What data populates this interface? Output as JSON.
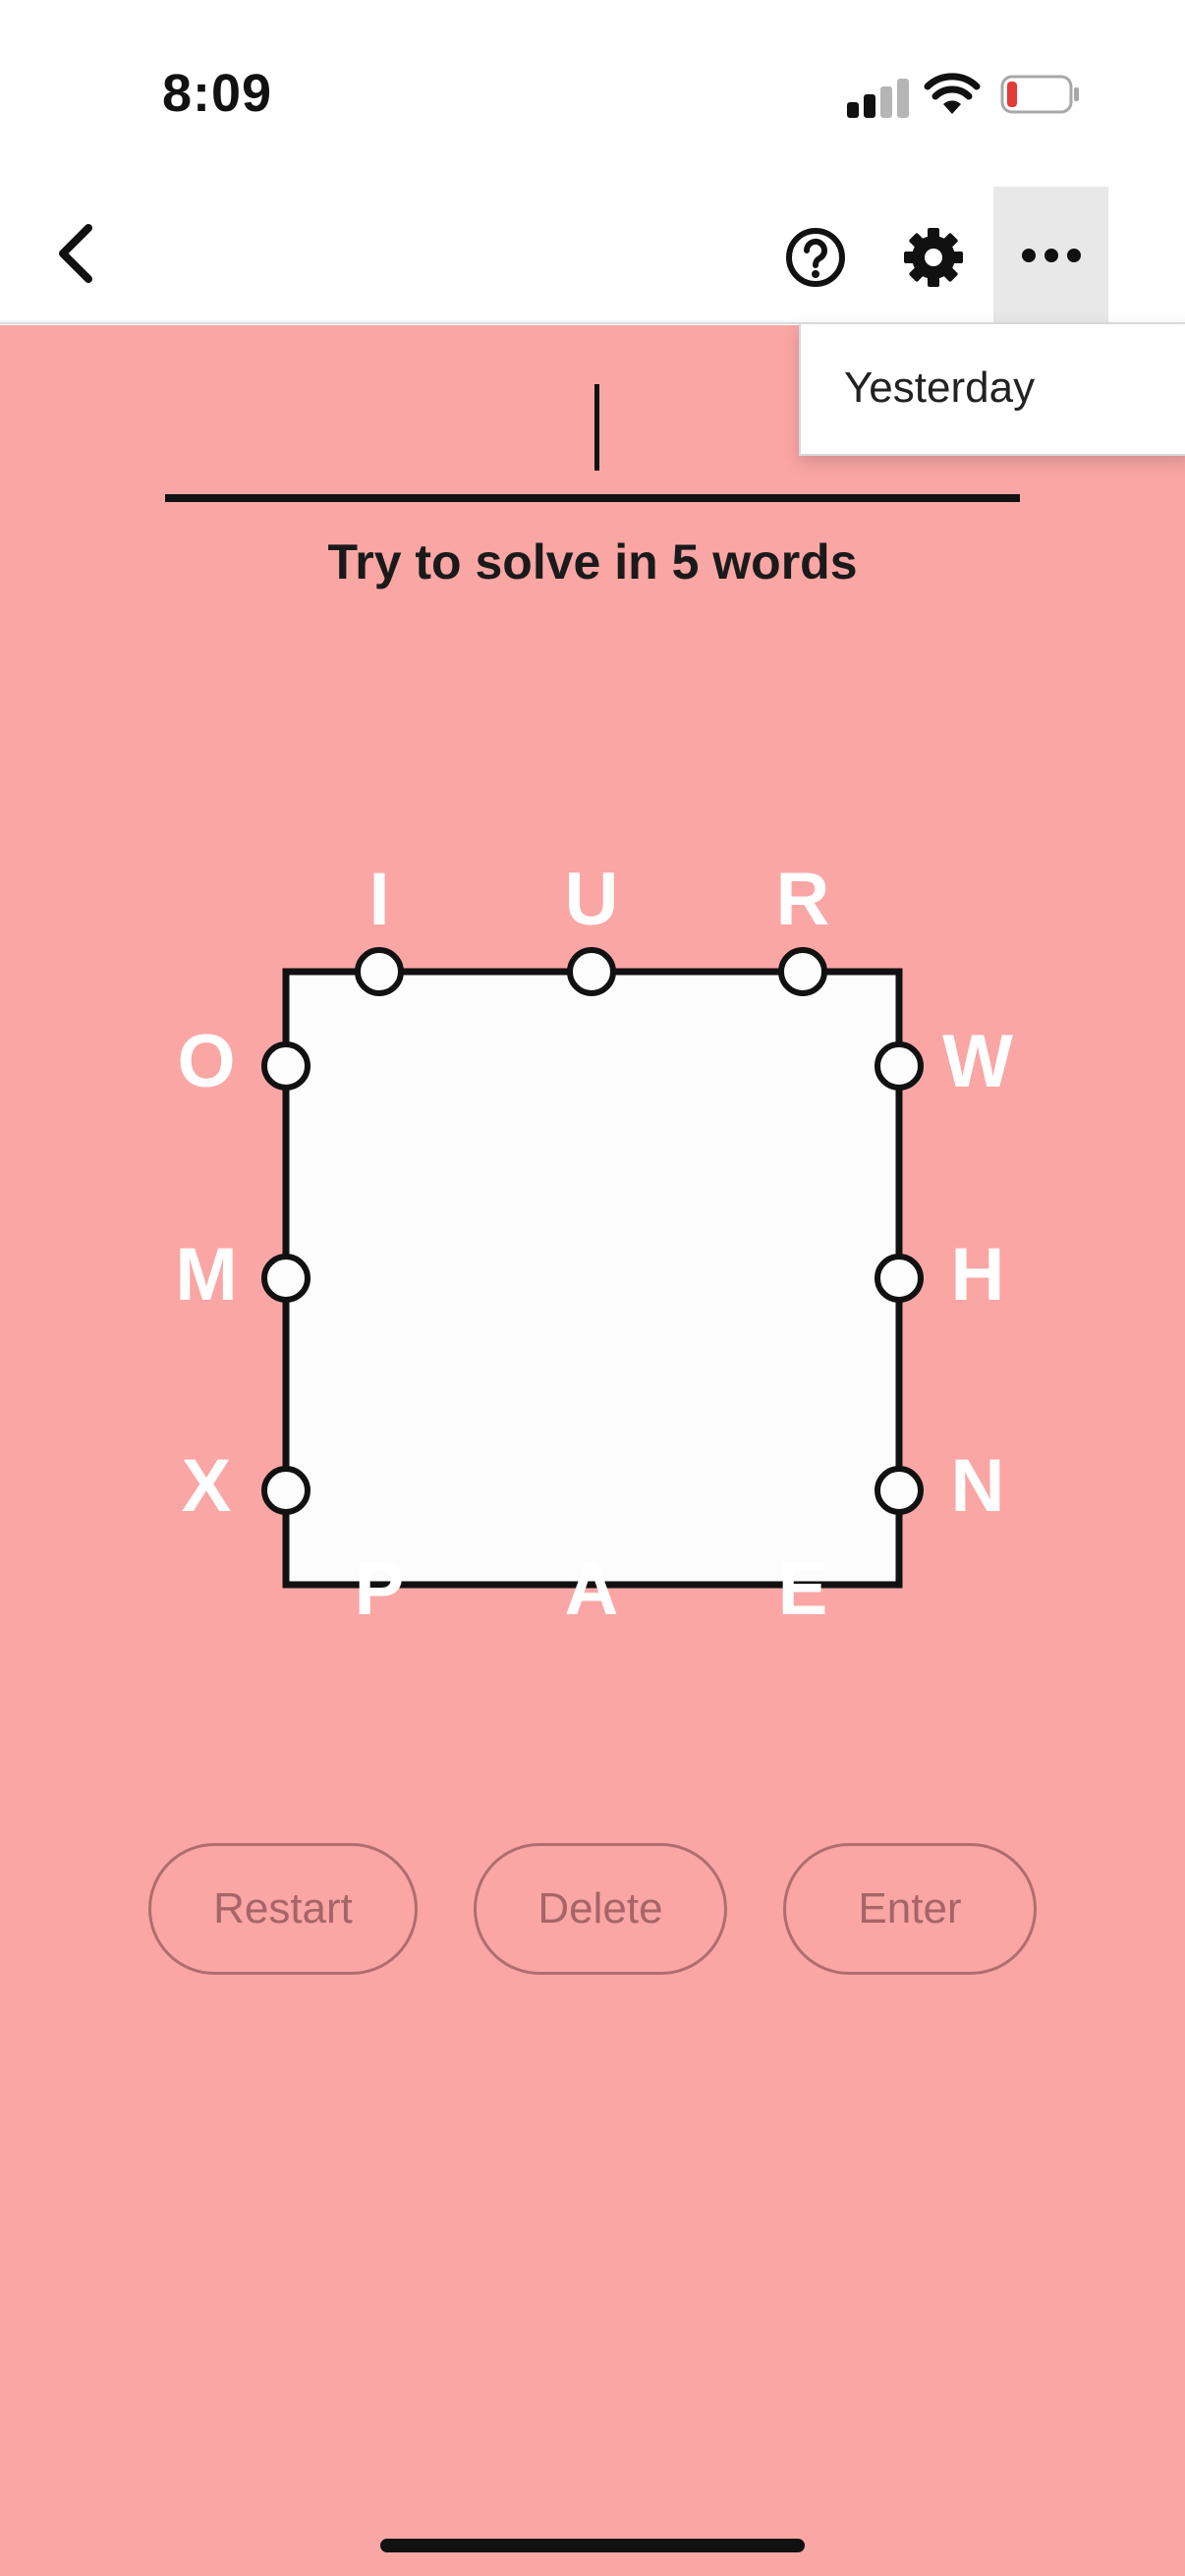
{
  "status_bar": {
    "time": "8:09",
    "icons": [
      "cellular-signal-icon",
      "wifi-icon",
      "battery-low-icon"
    ],
    "battery_color": "#e53935"
  },
  "nav": {
    "icons": [
      "chevron-left-icon",
      "question-circle-icon",
      "gear-icon",
      "ellipsis-icon"
    ]
  },
  "menu": {
    "items": [
      "Yesterday"
    ]
  },
  "game": {
    "current_word": "",
    "hint": "Try to solve in 5 words",
    "background_color": "#f9a6a5",
    "letters": {
      "top": [
        "I",
        "U",
        "R"
      ],
      "left": [
        "O",
        "M",
        "X"
      ],
      "right": [
        "W",
        "H",
        "N"
      ],
      "bottom": [
        "P",
        "A",
        "E"
      ]
    }
  },
  "controls": {
    "restart": "Restart",
    "delete": "Delete",
    "enter": "Enter"
  }
}
